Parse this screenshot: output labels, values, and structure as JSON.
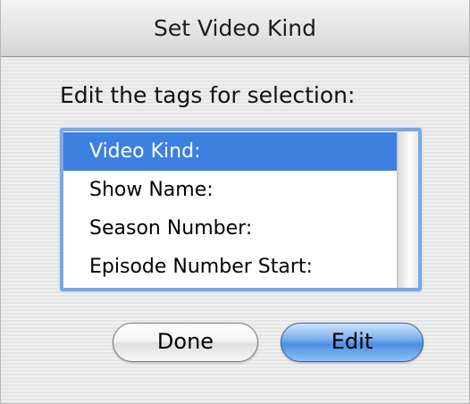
{
  "window": {
    "title": "Set Video Kind"
  },
  "dialog": {
    "prompt": "Edit the tags for selection:",
    "tags": [
      {
        "label": "Video Kind:",
        "selected": true
      },
      {
        "label": "Show Name:",
        "selected": false
      },
      {
        "label": "Season Number:",
        "selected": false
      },
      {
        "label": "Episode Number Start:",
        "selected": false
      }
    ],
    "buttons": {
      "done": "Done",
      "edit": "Edit"
    }
  },
  "colors": {
    "selection": "#3d80df",
    "focus_ring": "#7aa8e4",
    "default_button": "#4d8ee0"
  }
}
